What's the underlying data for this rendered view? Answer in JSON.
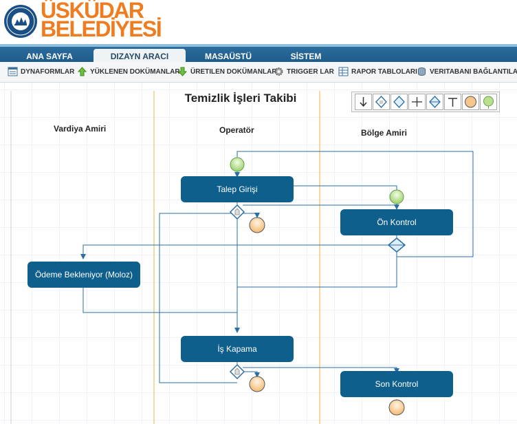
{
  "brand": {
    "line1": "ÜSKÜDAR",
    "line2": "BELEDİYESİ"
  },
  "nav": {
    "tabs": [
      "ANA SAYFA",
      "DIZAYN ARACI",
      "MASAÜSTÜ",
      "SİSTEM"
    ],
    "active": "DIZAYN ARACI"
  },
  "toolbar": {
    "items": [
      "DYNAFORMLAR",
      "YÜKLENEN DOKÜMANLAR",
      "ÜRETILEN DOKÜMANLAR",
      "TRIGGER LAR",
      "RAPOR TABLOLARI",
      "VERITABANI BAĞLANTILARI"
    ]
  },
  "process": {
    "title": "Temizlik İşleri Takibi",
    "lanes": [
      "Vardiya Amiri",
      "Operatör",
      "Bölge Amiri"
    ],
    "tasks": [
      "Talep Girişi",
      "Ön Kontrol",
      "Ödeme Bekleniyor (Moloz)",
      "İş Kapama",
      "Son Kontrol"
    ]
  },
  "palette": {
    "tools": [
      "sequential-arrow-icon",
      "selection-gateway-icon",
      "evaluation-gateway-icon",
      "parallel-fork-icon",
      "parallel-evaluation-icon",
      "parallel-join-icon",
      "end-event-icon",
      "start-event-icon"
    ]
  },
  "colors": {
    "task": "#0f5f8d",
    "nav": "#1e5b89",
    "brand": "#ef7d20",
    "lane_line": "#f0b040",
    "grid": "#e3e9f4"
  }
}
